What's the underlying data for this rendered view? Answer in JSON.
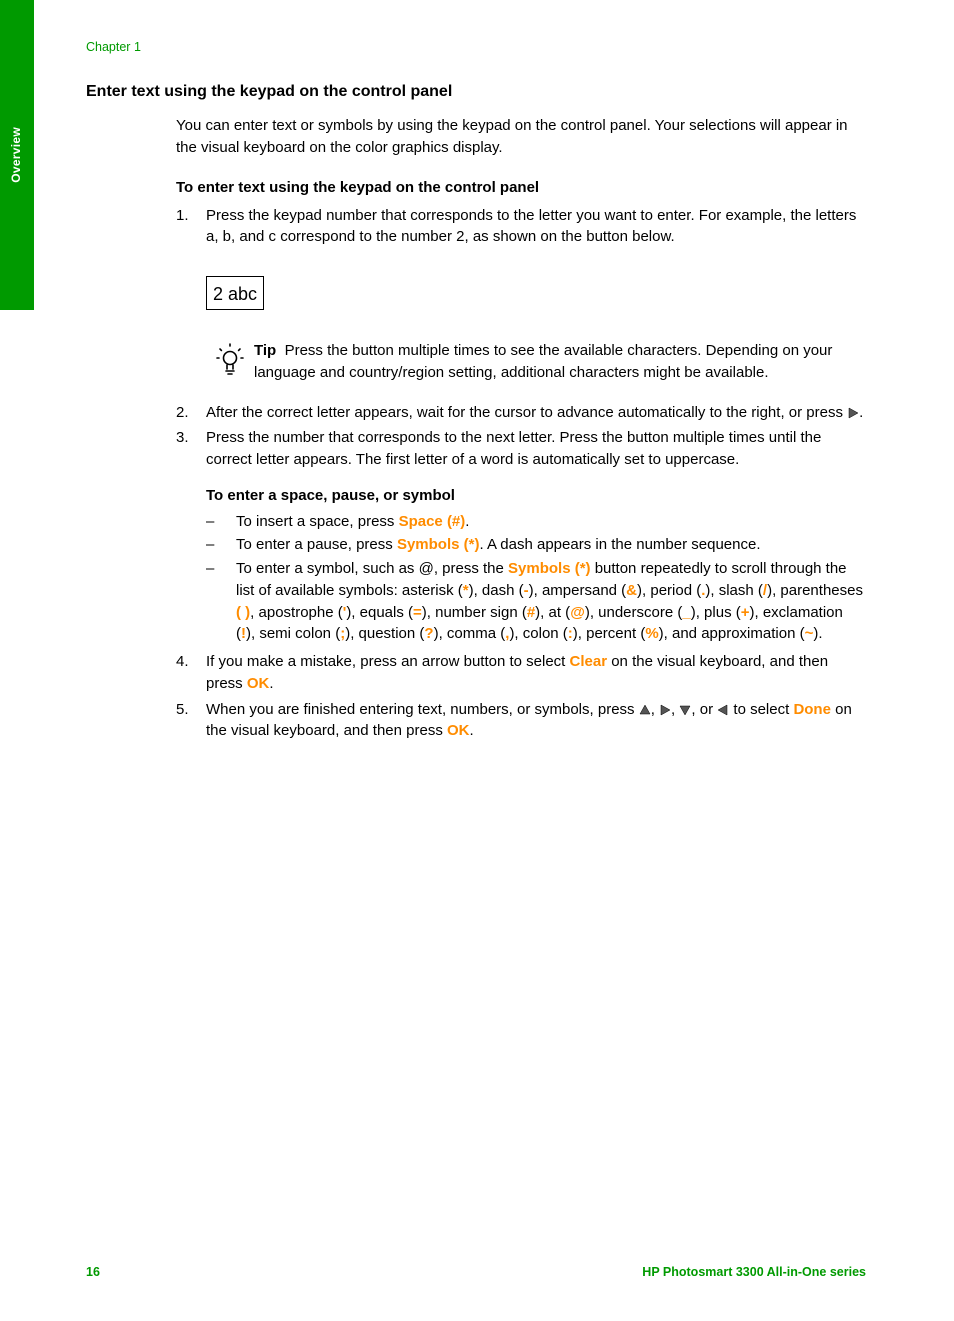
{
  "sidebar": {
    "label": "Overview"
  },
  "chapter": "Chapter 1",
  "section_title": "Enter text using the keypad on the control panel",
  "intro": "You can enter text or symbols by using the keypad on the control panel. Your selections will appear in the visual keyboard on the color graphics display.",
  "proc_heading": "To enter text using the keypad on the control panel",
  "steps": {
    "s1_num": "1.",
    "s1_text": "Press the keypad number that corresponds to the letter you want to enter. For example, the letters a, b, and c correspond to the number 2, as shown on the button below.",
    "keypad_label": "2 abc",
    "tip_label": "Tip",
    "tip_text": "Press the button multiple times to see the available characters. Depending on your language and country/region setting, additional characters might be available.",
    "s2_num": "2.",
    "s2_a": "After the correct letter appears, wait for the cursor to advance automatically to the right, or press ",
    "s2_b": ".",
    "s3_num": "3.",
    "s3_text": "Press the number that corresponds to the next letter. Press the button multiple times until the correct letter appears. The first letter of a word is automatically set to uppercase.",
    "sub_heading": "To enter a space, pause, or symbol",
    "b1_a": "To insert a space, press ",
    "b1_hl": "Space (#)",
    "b1_b": ".",
    "b2_a": "To enter a pause, press ",
    "b2_hl": "Symbols (*)",
    "b2_b": ". A dash appears in the number sequence.",
    "b3_a": "To enter a symbol, such as @, press the ",
    "b3_hl1": "Symbols (*)",
    "b3_b": " button repeatedly to scroll through the list of available symbols: asterisk (",
    "b3_sym_ast": "*",
    "b3_c": "), dash (",
    "b3_sym_dash": "-",
    "b3_d": "), ampersand (",
    "b3_sym_amp": "&",
    "b3_e": "), period (",
    "b3_sym_per": ".",
    "b3_f": "), slash (",
    "b3_sym_sl": "/",
    "b3_g": "), parentheses ",
    "b3_sym_par": "( )",
    "b3_h": ", apostrophe (",
    "b3_sym_apo": "'",
    "b3_i": "), equals (",
    "b3_sym_eq": "=",
    "b3_j": "), number sign (",
    "b3_sym_hash": "#",
    "b3_k": "), at (",
    "b3_sym_at": "@",
    "b3_l": "), underscore (",
    "b3_sym_us": "_",
    "b3_m": "), plus (",
    "b3_sym_plus": "+",
    "b3_n": "), exclamation (",
    "b3_sym_exc": "!",
    "b3_o": "), semi colon (",
    "b3_sym_sc": ";",
    "b3_p": "), question (",
    "b3_sym_q": "?",
    "b3_q": "), comma (",
    "b3_sym_com": ",",
    "b3_r": "), colon (",
    "b3_sym_col": ":",
    "b3_s": "), percent (",
    "b3_sym_pct": "%",
    "b3_t": "), and approximation (",
    "b3_sym_tld": "~",
    "b3_u": ").",
    "s4_num": "4.",
    "s4_a": "If you make a mistake, press an arrow button to select ",
    "s4_hl1": "Clear",
    "s4_b": " on the visual keyboard, and then press ",
    "s4_hl2": "OK",
    "s4_c": ".",
    "s5_num": "5.",
    "s5_a": "When you are finished entering text, numbers, or symbols, press ",
    "s5_comma1": ", ",
    "s5_comma2": ", ",
    "s5_or": ", or ",
    "s5_b": " to select ",
    "s5_hl1": "Done",
    "s5_c": " on the visual keyboard, and then press ",
    "s5_hl2": "OK",
    "s5_d": "."
  },
  "footer": {
    "page": "16",
    "product": "HP Photosmart 3300 All-in-One series"
  }
}
